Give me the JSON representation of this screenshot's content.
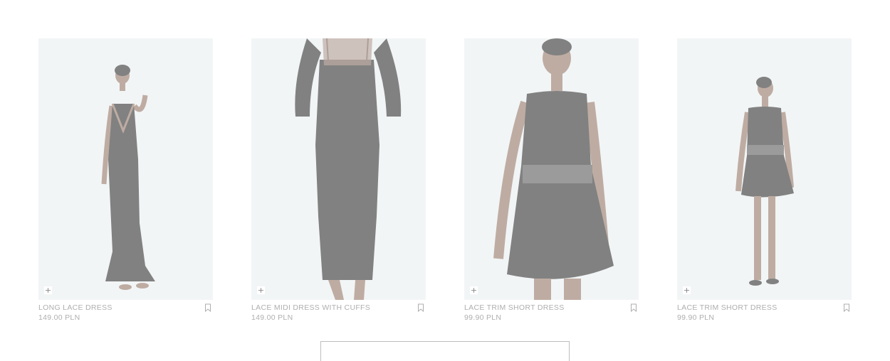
{
  "products": [
    {
      "name": "LONG LACE DRESS",
      "price": "149.00 PLN",
      "add_icon": "plus-icon",
      "bookmark_icon": "bookmark-icon"
    },
    {
      "name": "LACE MIDI DRESS WITH CUFFS",
      "price": "149.00 PLN",
      "add_icon": "plus-icon",
      "bookmark_icon": "bookmark-icon"
    },
    {
      "name": "LACE TRIM SHORT DRESS",
      "price": "99.90 PLN",
      "add_icon": "plus-icon",
      "bookmark_icon": "bookmark-icon"
    },
    {
      "name": "LACE TRIM SHORT DRESS",
      "price": "99.90 PLN",
      "add_icon": "plus-icon",
      "bookmark_icon": "bookmark-icon"
    }
  ],
  "add_symbol": "+",
  "colors": {
    "image_background": "#e9eef0",
    "dress": "#1b1b1b",
    "skin": "#8a6a58",
    "text": "#6c6c6c"
  }
}
